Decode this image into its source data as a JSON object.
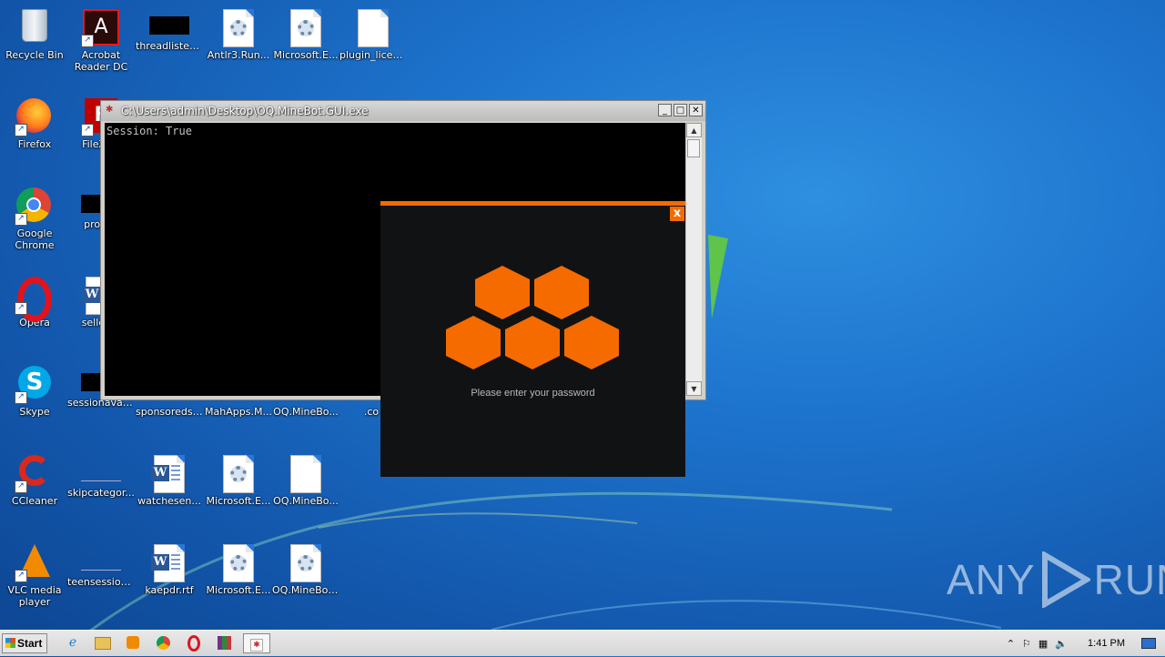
{
  "desktop": {
    "icons": [
      {
        "label": "Recycle Bin"
      },
      {
        "label": "Acrobat Reader DC"
      },
      {
        "label": "threadlisten..."
      },
      {
        "label": "Antlr3.Run..."
      },
      {
        "label": "Microsoft.E..."
      },
      {
        "label": "plugin_licen..."
      },
      {
        "label": "Firefox"
      },
      {
        "label": "FileZilla"
      },
      {
        "label": "Google Chrome"
      },
      {
        "label": "proced"
      },
      {
        "label": "Opera"
      },
      {
        "label": "sellersu"
      },
      {
        "label": "Skype"
      },
      {
        "label": "sessionavail..."
      },
      {
        "label": "sponsoredst..."
      },
      {
        "label": "MahApps.M..."
      },
      {
        "label": "OQ.MineBo..."
      },
      {
        "label": ".co"
      },
      {
        "label": "CCleaner"
      },
      {
        "label": "skipcategor..."
      },
      {
        "label": "watchesen..."
      },
      {
        "label": "Microsoft.E..."
      },
      {
        "label": "OQ.MineBo..."
      },
      {
        "label": "VLC media player"
      },
      {
        "label": "teensession..."
      },
      {
        "label": "kaepdr.rtf"
      },
      {
        "label": "Microsoft.E..."
      },
      {
        "label": "OQ.MineBot..."
      }
    ]
  },
  "console": {
    "title": "C:\\Users\\admin\\Desktop\\OQ.MineBot.GUI.exe",
    "output": "Session: True",
    "min_label": "_",
    "max_label": "□",
    "close_label": "✕"
  },
  "dialog": {
    "close_label": "x",
    "prompt": "Please enter your password",
    "accent_color": "#f56b00"
  },
  "watermark": {
    "left": "ANY",
    "right": "RUN"
  },
  "taskbar": {
    "start_label": "Start",
    "clock": "1:41 PM"
  }
}
